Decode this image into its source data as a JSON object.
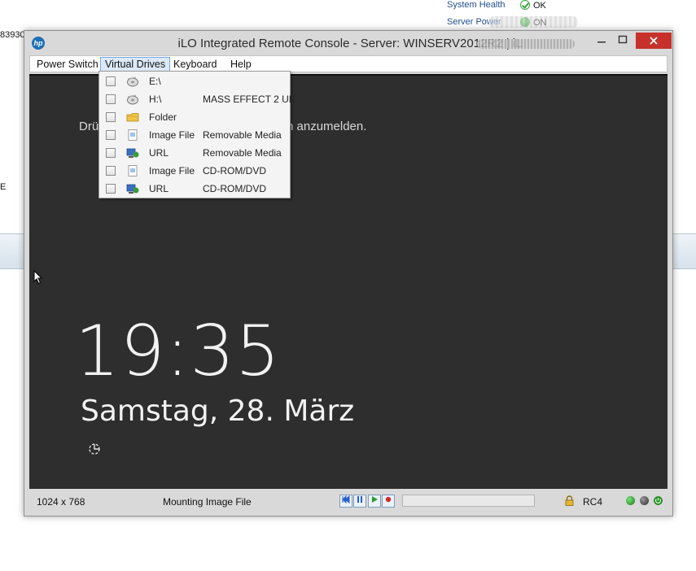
{
  "background": {
    "left_fragment": "83930",
    "left_fragment_e": "E",
    "system_health_label": "System Health",
    "system_health_value": "OK",
    "server_power_label": "Server Power",
    "server_power_value": "ON"
  },
  "window": {
    "title": "iLO Integrated Remote Console - Server: WINSERV2012R2 | iL",
    "minimize_icon": "minimize-icon",
    "maximize_icon": "maximize-icon",
    "close_icon": "close-icon"
  },
  "menu": {
    "power_switch": "Power Switch",
    "virtual_drives": "Virtual Drives",
    "keyboard": "Keyboard",
    "help": "Help"
  },
  "virtual_drives_menu": [
    {
      "label": "E:\\",
      "detail": "",
      "icon": "drive-icon"
    },
    {
      "label": "H:\\",
      "detail": "MASS EFFECT 2 UE",
      "icon": "drive-icon"
    },
    {
      "label": "Folder",
      "detail": "",
      "icon": "folder-icon"
    },
    {
      "label": "Image File",
      "detail": "Removable Media",
      "icon": "image-file-icon"
    },
    {
      "label": "URL",
      "detail": "Removable Media",
      "icon": "url-icon"
    },
    {
      "label": "Image File",
      "detail": "CD-ROM/DVD",
      "icon": "image-file-icon"
    },
    {
      "label": "URL",
      "detail": "CD-ROM/DVD",
      "icon": "url-icon"
    }
  ],
  "screen": {
    "press_text_start": "Drü",
    "press_text_end": "n anzumelden.",
    "time": "19:35",
    "date": "Samstag, 28. März"
  },
  "status": {
    "resolution": "1024 x 768",
    "message": "Mounting Image File",
    "progress": 0,
    "encryption": "RC4"
  },
  "colors": {
    "close_button": "#c7312b",
    "screen_bg": "#2e2e2e",
    "menu_highlight": "#dce9f8"
  }
}
